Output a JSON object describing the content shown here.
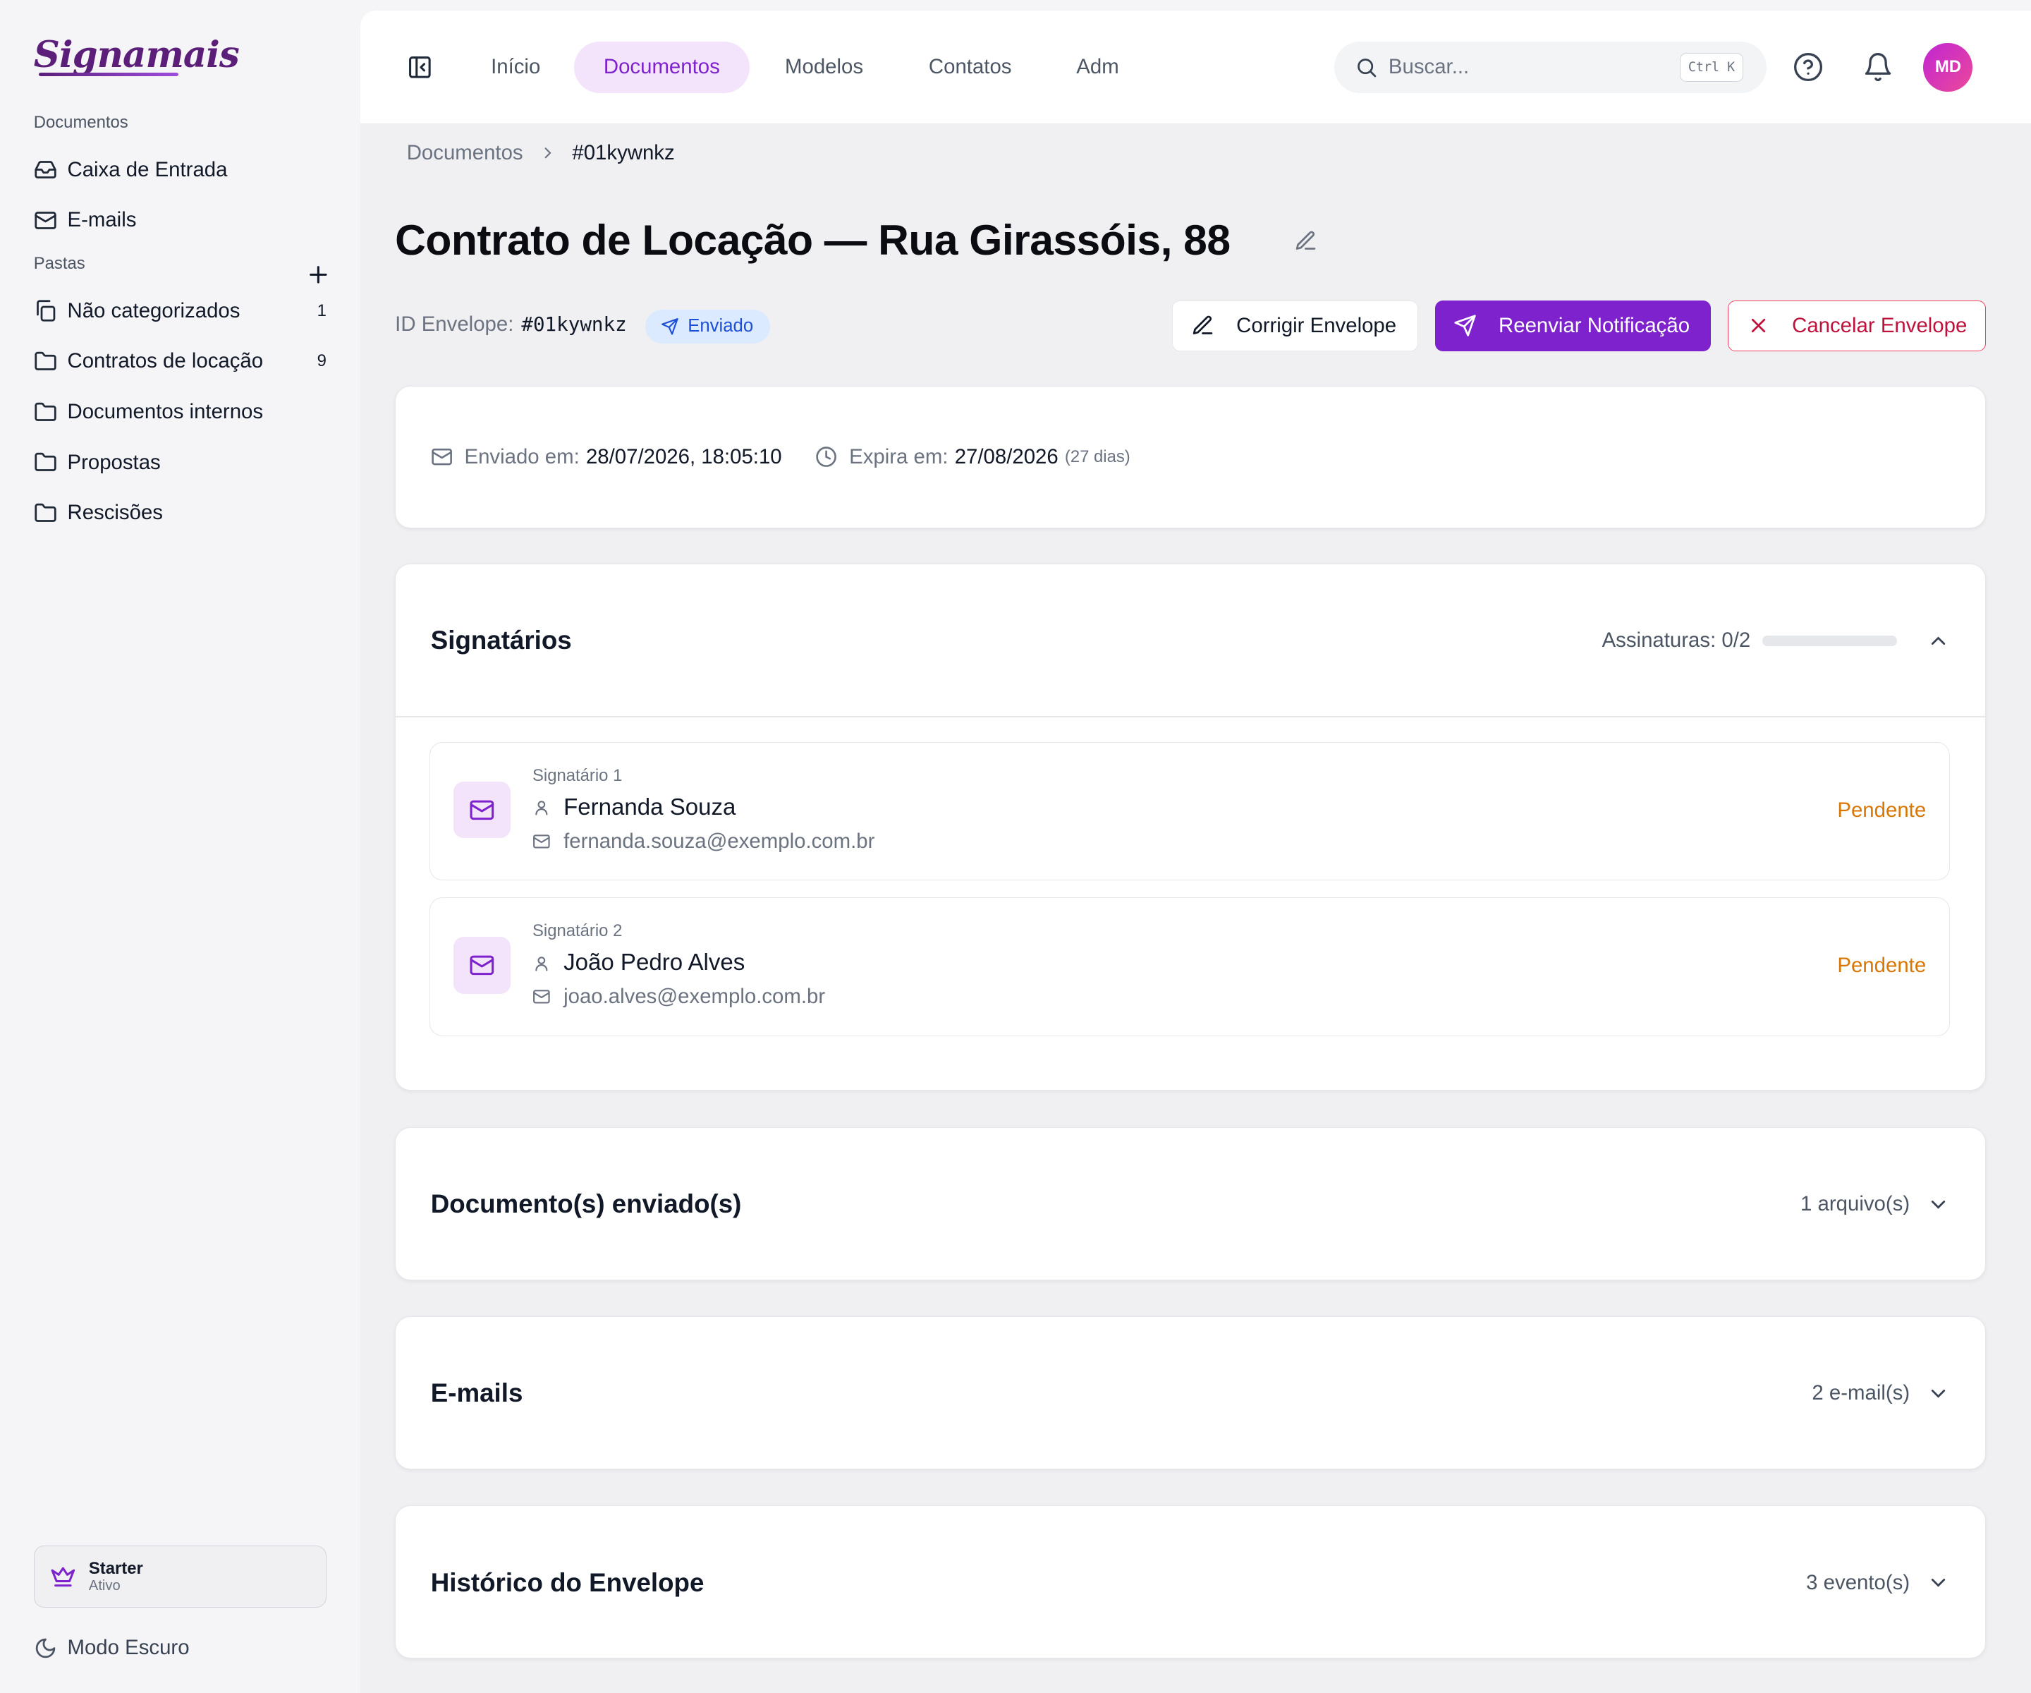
{
  "app": {
    "logo": "Signamais"
  },
  "sidebar": {
    "section_documents": "Documentos",
    "items_documents": [
      {
        "label": "Caixa de Entrada",
        "icon": "inbox-icon"
      },
      {
        "label": "E-mails",
        "icon": "mail-icon"
      }
    ],
    "section_folders": "Pastas",
    "folders": [
      {
        "label": "Não categorizados",
        "count": "1",
        "icon": "files-icon"
      },
      {
        "label": "Contratos de locação",
        "count": "9",
        "icon": "folder-icon"
      },
      {
        "label": "Documentos internos",
        "count": "",
        "icon": "folder-icon"
      },
      {
        "label": "Propostas",
        "count": "",
        "icon": "folder-icon"
      },
      {
        "label": "Rescisões",
        "count": "",
        "icon": "folder-icon"
      }
    ],
    "plan": {
      "name": "Starter",
      "status": "Ativo"
    },
    "dark_mode": "Modo Escuro"
  },
  "topbar": {
    "tabs": [
      {
        "label": "Início",
        "active": false
      },
      {
        "label": "Documentos",
        "active": true
      },
      {
        "label": "Modelos",
        "active": false
      },
      {
        "label": "Contatos",
        "active": false
      },
      {
        "label": "Adm",
        "active": false
      }
    ],
    "search_placeholder": "Buscar...",
    "search_shortcut": "Ctrl K",
    "avatar_initials": "MD"
  },
  "breadcrumb": {
    "parent": "Documentos",
    "current": "#01kywnkz"
  },
  "document": {
    "title": "Contrato de Locação — Rua Girassóis, 88",
    "id_label": "ID Envelope:",
    "id_value": "#01kywnkz",
    "status": "Enviado",
    "actions": {
      "fix": "Corrigir Envelope",
      "resend": "Reenviar Notificação",
      "cancel": "Cancelar Envelope"
    },
    "sent_label": "Enviado em:",
    "sent_value": "28/07/2026, 18:05:10",
    "expires_label": "Expira em:",
    "expires_value": "27/08/2026",
    "expires_note": "(27 dias)"
  },
  "signers_section": {
    "title": "Signatários",
    "progress_label": "Assinaturas: 0/2",
    "progress_fraction": 0,
    "signers": [
      {
        "label": "Signatário 1",
        "name": "Fernanda Souza",
        "email": "fernanda.souza@exemplo.com.br",
        "status": "Pendente"
      },
      {
        "label": "Signatário 2",
        "name": "João Pedro Alves",
        "email": "joao.alves@exemplo.com.br",
        "status": "Pendente"
      }
    ]
  },
  "sections": {
    "documents": {
      "title": "Documento(s) enviado(s)",
      "summary": "1 arquivo(s)"
    },
    "emails": {
      "title": "E-mails",
      "summary": "2 e-mail(s)"
    },
    "history": {
      "title": "Histórico do Envelope",
      "summary": "3 evento(s)"
    }
  },
  "colors": {
    "accent": "#7e22ce",
    "accent_soft": "#f3e3fb",
    "pending": "#d97706",
    "danger": "#be123c",
    "badge_blue": "#1d4ed8"
  }
}
